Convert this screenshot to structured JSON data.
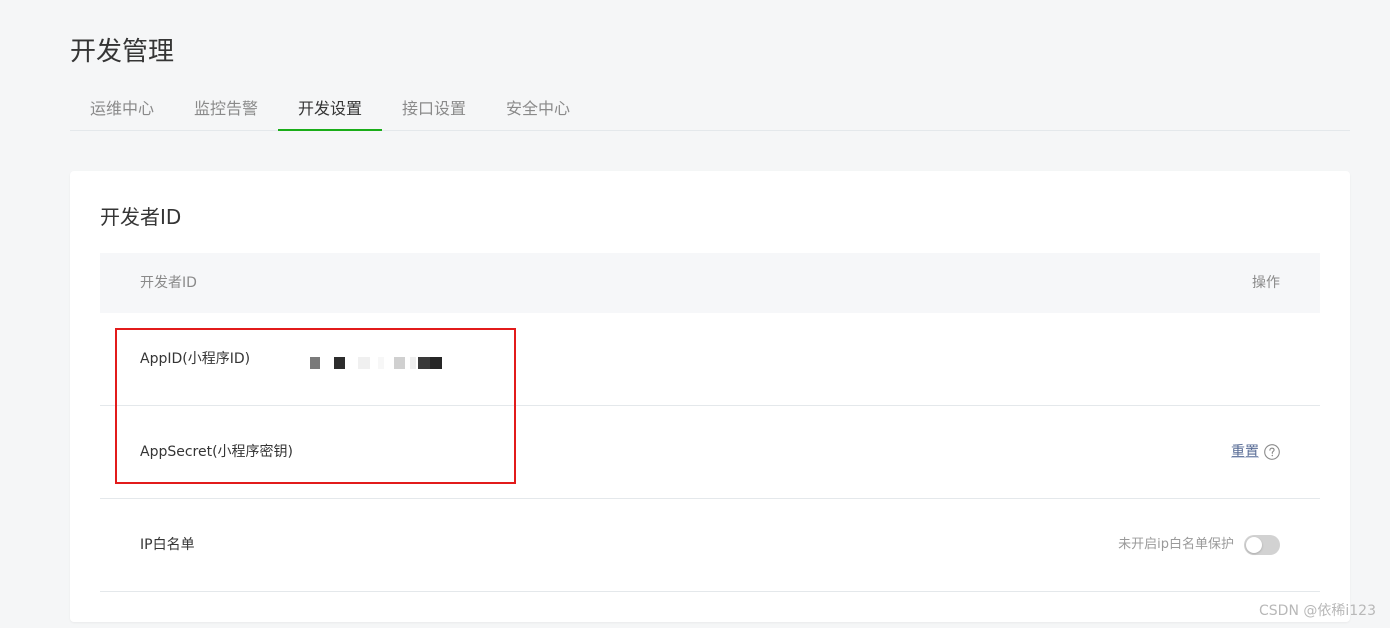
{
  "page": {
    "title": "开发管理"
  },
  "tabs": [
    {
      "label": "运维中心",
      "active": false
    },
    {
      "label": "监控告警",
      "active": false
    },
    {
      "label": "开发设置",
      "active": true
    },
    {
      "label": "接口设置",
      "active": false
    },
    {
      "label": "安全中心",
      "active": false
    }
  ],
  "developer_id": {
    "section_title": "开发者ID",
    "columns": {
      "id": "开发者ID",
      "action": "操作"
    },
    "rows": {
      "appid": {
        "label": "AppID(小程序ID)",
        "value_redacted": true
      },
      "appsecret": {
        "label": "AppSecret(小程序密钥)",
        "action_label": "重置",
        "help_icon": "question-circle-icon"
      },
      "ip_whitelist": {
        "label": "IP白名单",
        "status_text": "未开启ip白名单保护",
        "toggle_on": false
      }
    }
  },
  "colors": {
    "accent_green": "#1aad19",
    "link_blue": "#576b95",
    "highlight_red": "#e21b1b"
  },
  "watermark": "CSDN @依稀i123"
}
